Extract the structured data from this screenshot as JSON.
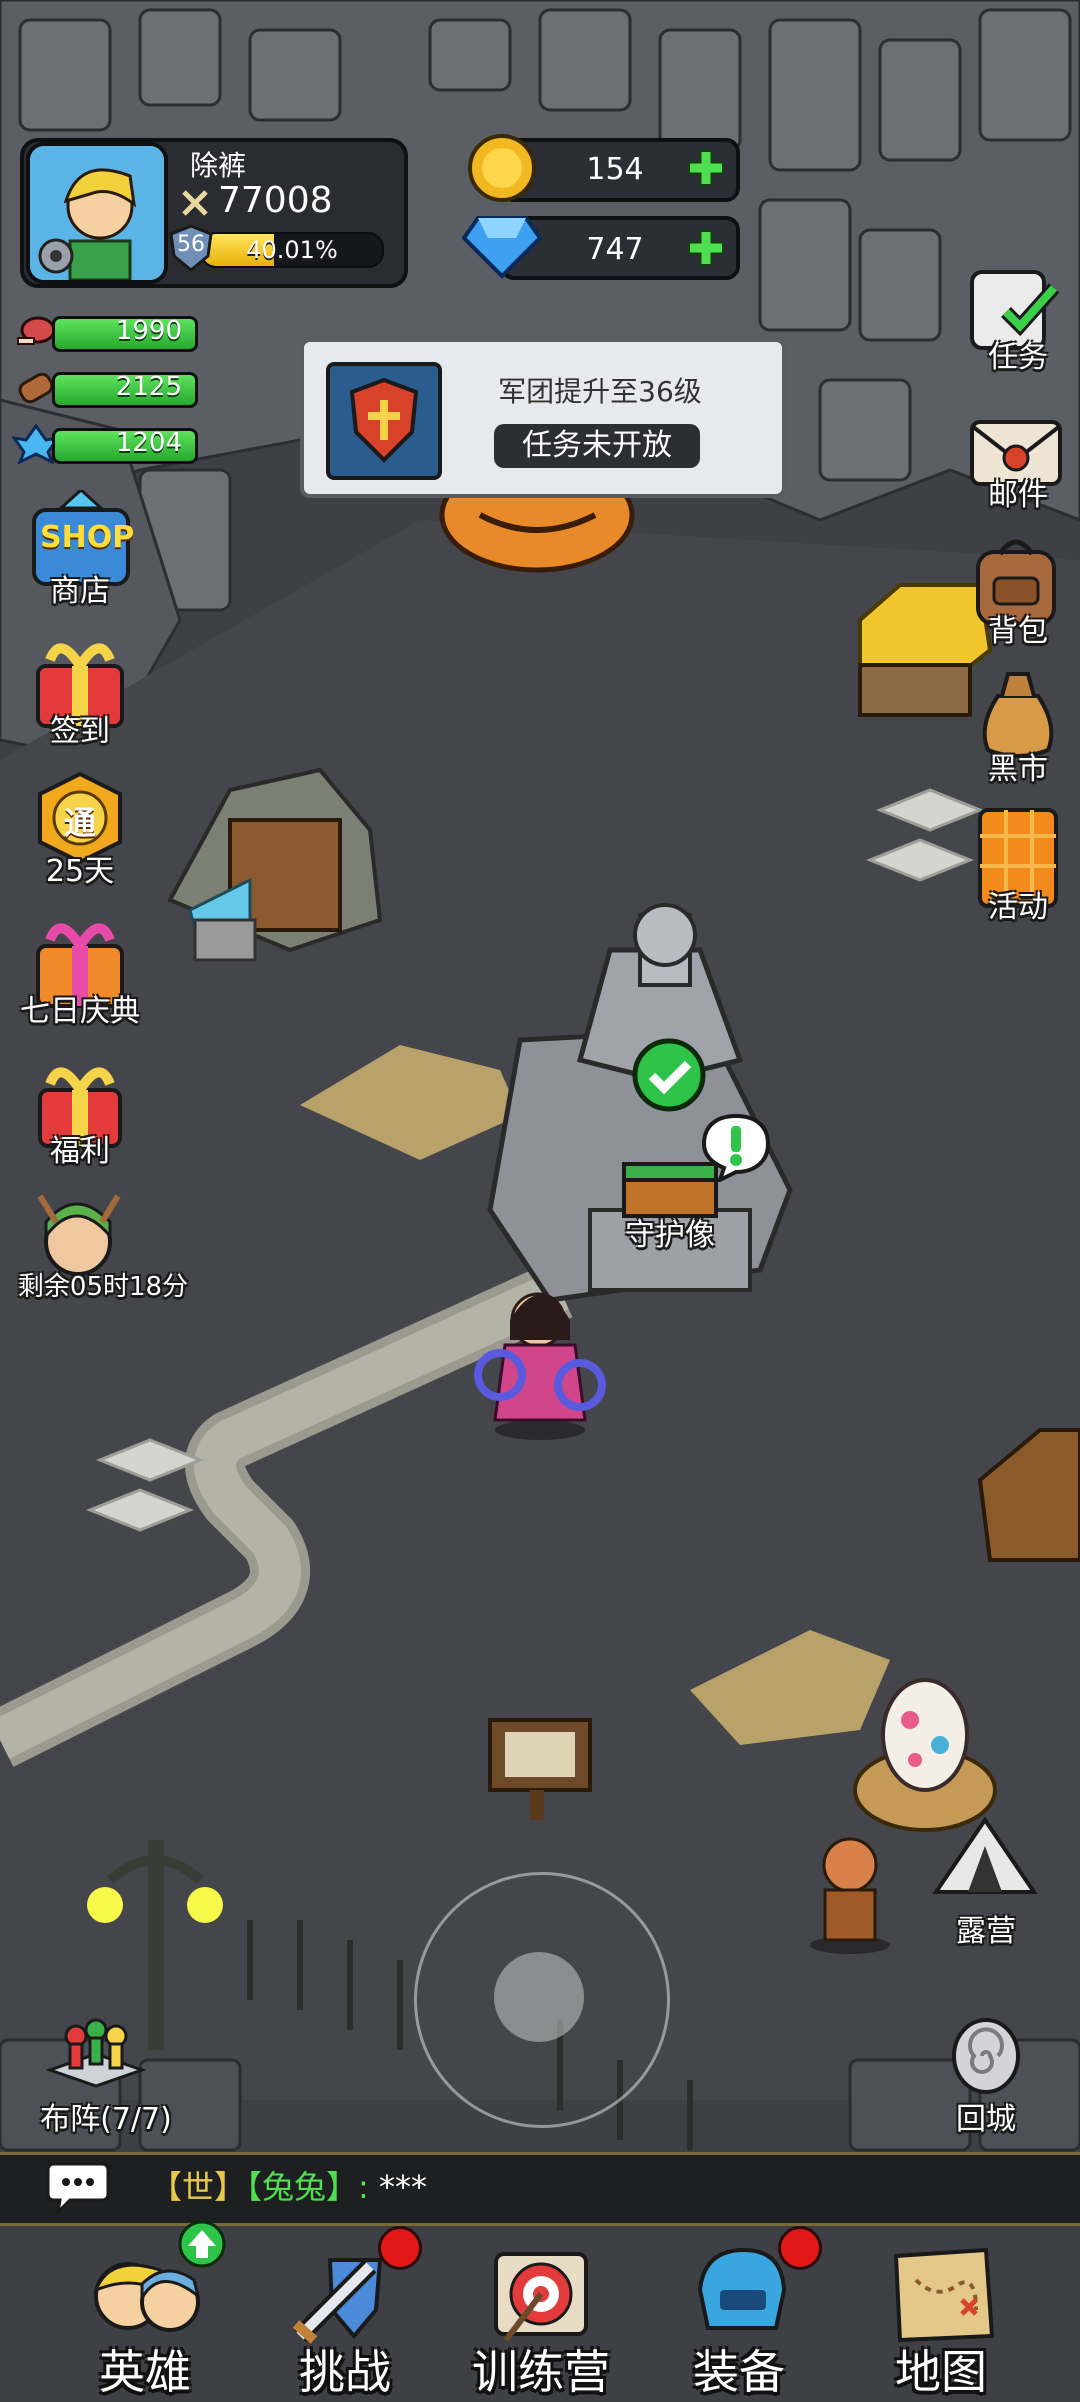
{
  "player": {
    "name": "除裤",
    "power": "77008",
    "level": "56",
    "exp_percent": "40.01%",
    "exp_fraction": 0.4001
  },
  "currency": {
    "gold": "154",
    "diamond": "747"
  },
  "resources": {
    "meat": "1990",
    "wood": "2125",
    "crystal": "1204"
  },
  "quest": {
    "title": "军团提升至36级",
    "status": "任务未开放"
  },
  "left_menu": {
    "shop_badge": "SHOP",
    "shop": "商店",
    "checkin": "签到",
    "pass_badge": "通",
    "pass_days": "25天",
    "seven_day": "七日庆典",
    "welfare": "福利",
    "timer": "剩余05时18分"
  },
  "right_menu": {
    "tasks": "任务",
    "mail": "邮件",
    "bag": "背包",
    "black_market": "黑市",
    "events": "活动"
  },
  "map": {
    "guardian_statue": "守护像",
    "camp": "露营",
    "return_city": "回城",
    "formation": "布阵(7/7)"
  },
  "chat": {
    "channel": "【世】",
    "sender": "【兔兔】:",
    "message": "***"
  },
  "bottom_nav": {
    "heroes": "英雄",
    "challenge": "挑战",
    "training": "训练营",
    "equipment": "装备",
    "map": "地图"
  },
  "colors": {
    "resource_green": "#4fd24f",
    "badge_red": "#e01818",
    "sender_green": "#4fe04f",
    "channel_gold": "#e8c84a"
  }
}
